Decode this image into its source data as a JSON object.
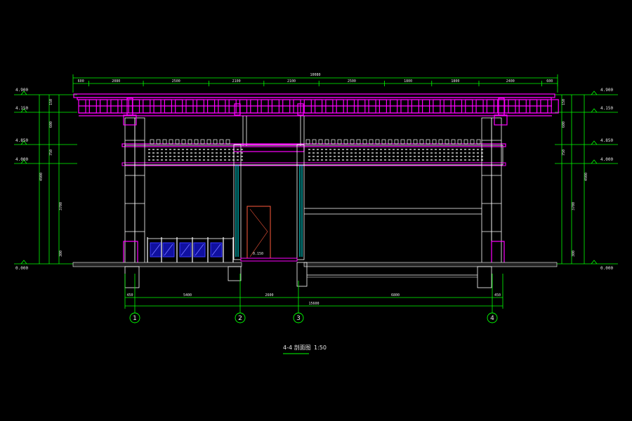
{
  "drawing": {
    "caption": "4-4 剖面图",
    "scale": "1:50",
    "colors": {
      "background": "#000000",
      "beam": "#ff00ff",
      "wall": "#ffffff",
      "dimension": "#00ff00",
      "glass": "#00ffff",
      "railing": "#3a3aff",
      "door": "#ff5a3c"
    }
  },
  "top_dimensions": {
    "overall": "10080",
    "segments": [
      "600",
      "2080",
      "2500",
      "2100",
      "2100",
      "2500",
      "1800",
      "1800",
      "2400",
      "600"
    ]
  },
  "bottom_dimensions": {
    "overall": "15600",
    "segments": [
      "450",
      "5400",
      "2600",
      "6800",
      "450"
    ]
  },
  "levels_left": [
    "4.900",
    "4.150",
    "4.850",
    "4.000",
    "0.000"
  ],
  "levels_right": [
    "4.900",
    "4.150",
    "4.850",
    "4.000",
    "0.000"
  ],
  "vertical_dims_left": [
    "4900",
    "4000",
    "150",
    "600",
    "750",
    "150",
    "3700",
    "300"
  ],
  "vertical_dims_right": [
    "4900",
    "4000",
    "150",
    "600",
    "750",
    "150",
    "3700",
    "300"
  ],
  "axes": [
    "1",
    "2",
    "3",
    "4"
  ],
  "annotations": {
    "step_level": "0.150"
  }
}
